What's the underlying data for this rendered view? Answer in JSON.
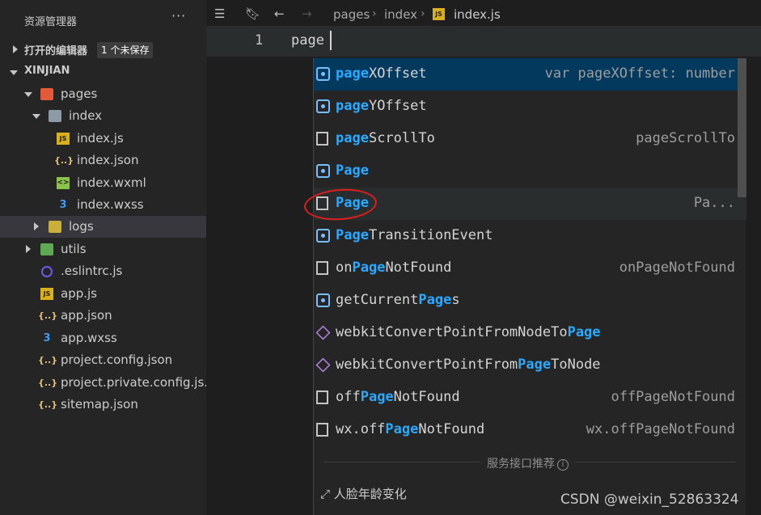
{
  "sidebar": {
    "title": "资源管理器",
    "more": "···",
    "open_editors_label": "打开的编辑器",
    "unsaved_badge": "1 个未保存",
    "project_name": "XINJIAN",
    "tree": [
      {
        "label": "pages"
      },
      {
        "label": "index"
      },
      {
        "label": "index.js"
      },
      {
        "label": "index.json"
      },
      {
        "label": "index.wxml"
      },
      {
        "label": "index.wxss"
      },
      {
        "label": "logs"
      },
      {
        "label": "utils"
      },
      {
        "label": ".eslintrc.js"
      },
      {
        "label": "app.js"
      },
      {
        "label": "app.json"
      },
      {
        "label": "app.wxss"
      },
      {
        "label": "project.config.json"
      },
      {
        "label": "project.private.config.js..."
      },
      {
        "label": "sitemap.json"
      }
    ]
  },
  "editor": {
    "breadcrumb": [
      "pages",
      "index",
      "index.js"
    ],
    "line_number": "1",
    "code": "page"
  },
  "suggest": {
    "items": [
      {
        "pre": "",
        "hl": "page",
        "post": "XOffset",
        "detail": "var pageXOffset: number"
      },
      {
        "pre": "",
        "hl": "page",
        "post": "YOffset",
        "detail": ""
      },
      {
        "pre": "",
        "hl": "page",
        "post": "ScrollTo",
        "detail": "pageScrollTo"
      },
      {
        "pre": "",
        "hl": "Page",
        "post": "",
        "detail": ""
      },
      {
        "pre": "",
        "hl": "Page",
        "post": "",
        "detail": "Pa..."
      },
      {
        "pre": "",
        "hl": "Page",
        "post": "TransitionEvent",
        "detail": ""
      },
      {
        "pre": "on",
        "hl": "Page",
        "post": "NotFound",
        "detail": "onPageNotFound"
      },
      {
        "pre": "getCurrent",
        "hl": "Page",
        "post": "s",
        "detail": ""
      },
      {
        "pre": "webkitConvertPointFromNodeTo",
        "hl": "Page",
        "post": "",
        "detail": ""
      },
      {
        "pre": "webkitConvertPointFrom",
        "hl": "Page",
        "post": "ToNode",
        "detail": ""
      },
      {
        "pre": "off",
        "hl": "Page",
        "post": "NotFound",
        "detail": "offPageNotFound"
      },
      {
        "pre": "wx.off",
        "hl": "Page",
        "post": "NotFound",
        "detail": "wx.offPageNotFound"
      }
    ],
    "footer_label": "服务接口推荐",
    "footer_info": "i",
    "bottom_item": "人脸年龄变化"
  },
  "watermark": "CSDN @weixin_52863324"
}
